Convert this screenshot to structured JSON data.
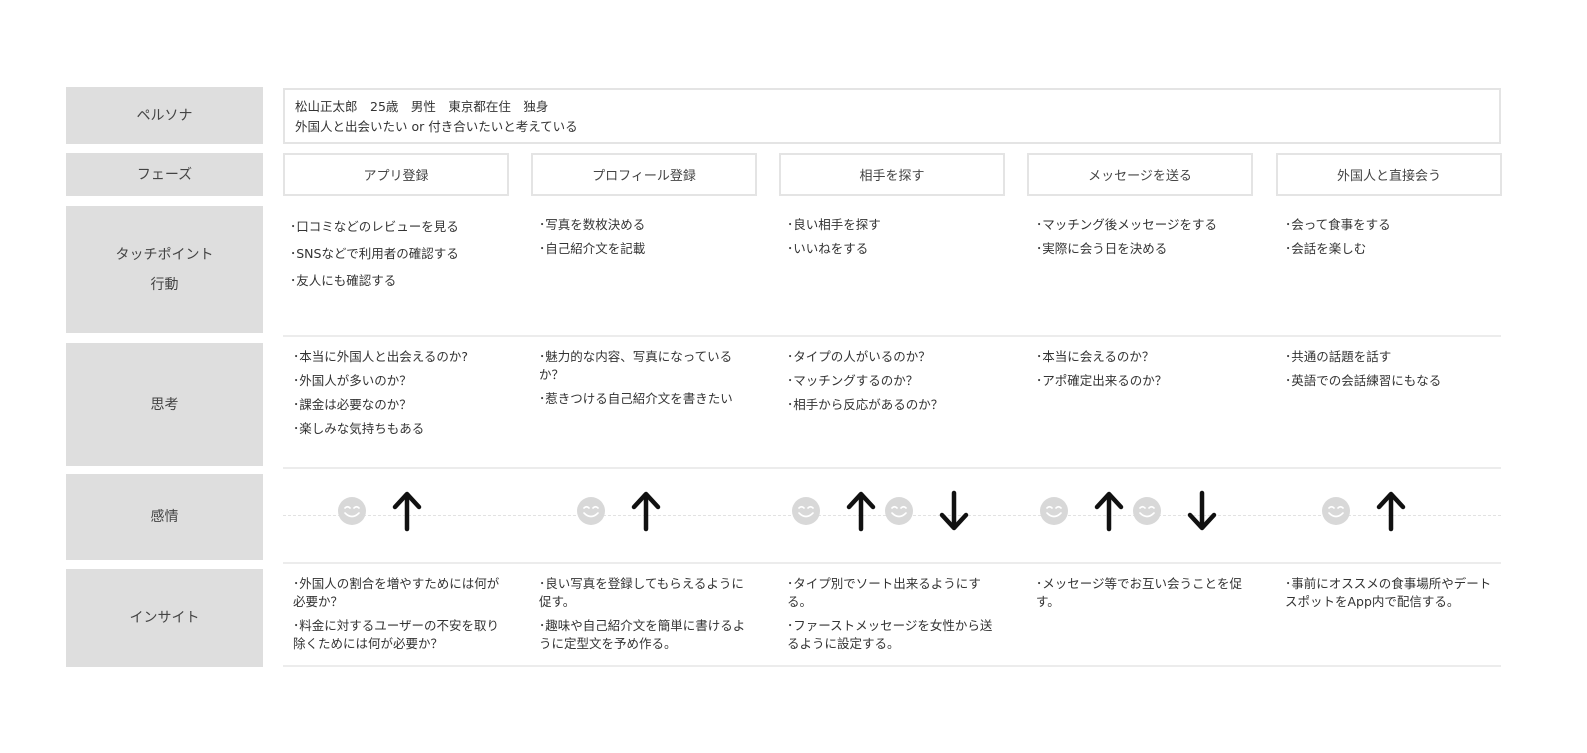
{
  "row_labels": {
    "persona": "ペルソナ",
    "phase": "フェーズ",
    "touchpoint_line1": "タッチポイント",
    "touchpoint_line2": "行動",
    "thought": "思考",
    "emotion": "感情",
    "insight": "インサイト"
  },
  "persona": {
    "line1": "松山正太郎　25歳　男性　東京都在住　独身",
    "line2": "外国人と出会いたい or 付き合いたいと考えている"
  },
  "phases": [
    "アプリ登録",
    "プロフィール登録",
    "相手を探す",
    "メッセージを送る",
    "外国人と直接会う"
  ],
  "touchpoints": [
    [
      "･口コミなどのレビューを見る",
      "･SNSなどで利用者の確認する",
      "･友人にも確認する"
    ],
    [
      "･写真を数枚決める",
      "･自己紹介文を記載"
    ],
    [
      "･良い相手を探す",
      "･いいねをする"
    ],
    [
      "･マッチング後メッセージをする",
      "･実際に会う日を決める"
    ],
    [
      "･会って食事をする",
      "･会話を楽しむ"
    ]
  ],
  "thoughts": [
    [
      "･本当に外国人と出会えるのか?",
      "･外国人が多いのか？",
      "･課金は必要なのか？",
      "･楽しみな気持ちもある"
    ],
    [
      "･魅力的な内容、写真になっているか？",
      "･惹きつける自己紹介文を書きたい"
    ],
    [
      "･タイプの人がいるのか？",
      "･マッチングするのか？",
      "･相手から反応があるのか？"
    ],
    [
      "･本当に会えるのか？",
      "･アポ確定出来るのか？"
    ],
    [
      "･共通の話題を話す",
      "･英語での会話練習にもなる"
    ]
  ],
  "emotions": [
    [
      "up"
    ],
    [
      "up"
    ],
    [
      "up",
      "down"
    ],
    [
      "up",
      "down"
    ],
    [
      "up"
    ]
  ],
  "insights": [
    [
      "･外国人の割合を増やすためには何が必要か？",
      "･料金に対するユーザーの不安を取り除くためには何が必要か？"
    ],
    [
      "･良い写真を登録してもらえるように促す。",
      "･趣味や自己紹介文を簡単に書けるように定型文を予め作る。"
    ],
    [
      "･タイプ別でソート出来るようにする。",
      "･ファーストメッセージを女性から送るように設定する。"
    ],
    [
      "･メッセージ等でお互い会うことを促す。"
    ],
    [
      "･事前にオススメの食事場所やデートスポットをApp内で配信する。"
    ]
  ],
  "colors": {
    "label_bg": "#dedede",
    "border": "#e4e4e4",
    "face": "#d8d8d8",
    "arrow": "#111111"
  }
}
